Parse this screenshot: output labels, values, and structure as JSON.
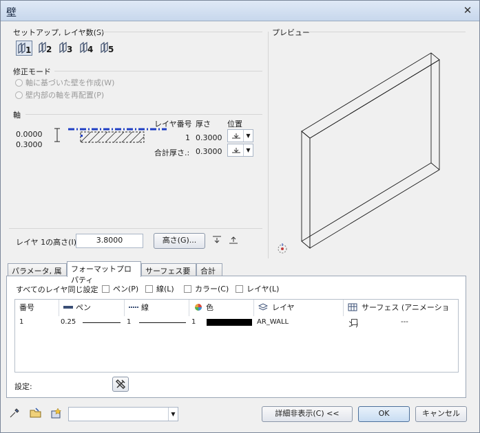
{
  "window": {
    "title": "壁",
    "close": "✕"
  },
  "setup": {
    "label": "セットアップ, レイヤ数(S)",
    "layer_buttons": [
      "1",
      "2",
      "3",
      "4",
      "5"
    ]
  },
  "mode": {
    "label": "修正モード",
    "options": [
      "軸に基づいた壁を作成(W)",
      "壁内部の軸を再配置(P)"
    ]
  },
  "axis": {
    "label": "軸",
    "values": [
      "0.0000",
      "0.3000"
    ],
    "col_layer": "レイヤ番号",
    "col_thick": "厚さ",
    "col_pos": "位置",
    "row_layer": "1",
    "row_thick": "0.3000",
    "total_label": "合計厚さ.:",
    "total_value": "0.3000"
  },
  "height": {
    "label": "レイヤ 1の高さ(I):",
    "value": "3.8000",
    "button": "高さ(G)..."
  },
  "preview_label": "プレビュー",
  "tabs": [
    "パラメータ, 属性",
    "フォーマットプロパティ",
    "サーフェス要素",
    "合計"
  ],
  "format": {
    "same_label": "すべてのレイヤ同じ設定",
    "checks": [
      "ペン(P)",
      "線(L)",
      "カラー(C)",
      "レイヤ(L)"
    ],
    "columns": [
      "番号",
      "ペン",
      "線",
      "色",
      "レイヤ",
      "サーフェス (アニメーション)"
    ],
    "row": {
      "num": "1",
      "pen": "0.25",
      "line": "1",
      "color": "1",
      "layer": "AR_WALL",
      "surface": "---"
    },
    "settings_label": "設定:"
  },
  "footer": {
    "combo_value": "",
    "details_button": "詳細非表示(C) <<",
    "ok_button": "OK",
    "cancel_button": "キャンセル"
  },
  "colors": {
    "accent": "#1f3fc4",
    "title_bg": "#d3e1f3"
  }
}
